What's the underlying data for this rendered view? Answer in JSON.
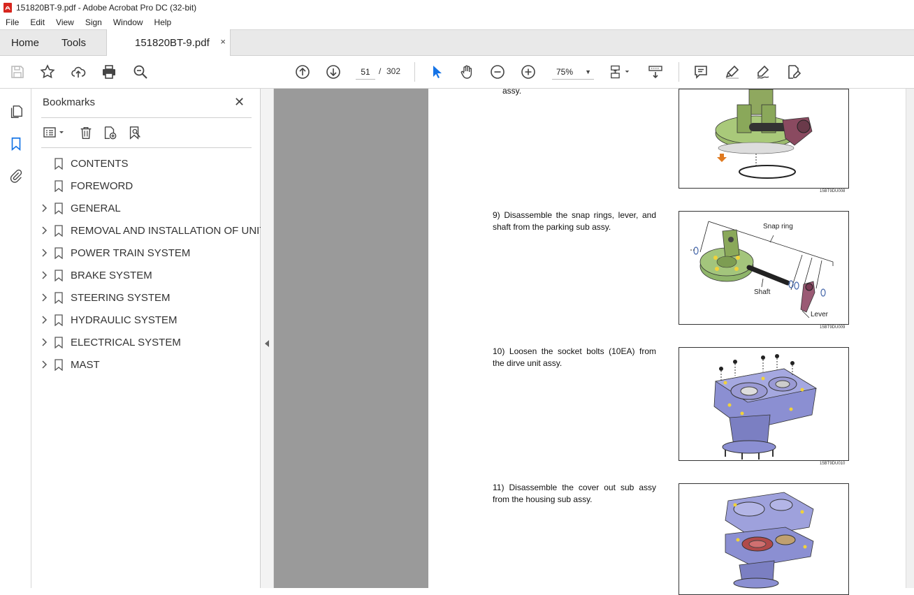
{
  "window": {
    "title": "151820BT-9.pdf - Adobe Acrobat Pro DC (32-bit)"
  },
  "menu": [
    "File",
    "Edit",
    "View",
    "Sign",
    "Window",
    "Help"
  ],
  "tabs": {
    "home": "Home",
    "tools": "Tools",
    "document": "151820BT-9.pdf",
    "close": "×"
  },
  "toolbar": {
    "current_page": "51",
    "separator": "/",
    "total_pages": "302",
    "zoom": "75%"
  },
  "bookmarks": {
    "title": "Bookmarks",
    "close": "✕",
    "items": [
      {
        "label": "CONTENTS",
        "expandable": false
      },
      {
        "label": "FOREWORD",
        "expandable": false
      },
      {
        "label": "GENERAL",
        "expandable": true
      },
      {
        "label": "REMOVAL AND INSTALLATION OF UNIT",
        "expandable": true
      },
      {
        "label": "POWER TRAIN SYSTEM",
        "expandable": true
      },
      {
        "label": "BRAKE SYSTEM",
        "expandable": true
      },
      {
        "label": "STEERING SYSTEM",
        "expandable": true
      },
      {
        "label": "HYDRAULIC SYSTEM",
        "expandable": true
      },
      {
        "label": "ELECTRICAL SYSTEM",
        "expandable": true
      },
      {
        "label": "MAST",
        "expandable": true
      }
    ]
  },
  "document": {
    "prev_fragment": "assy.",
    "steps": [
      {
        "num": "9)",
        "text": "Disassemble the snap rings, lever, and shaft from the parking sub assy."
      },
      {
        "num": "10)",
        "text": "Loosen the socket bolts (10EA) from the dirve unit assy."
      },
      {
        "num": "11)",
        "text": "Disassemble the cover out sub assy from the housing sub assy."
      }
    ],
    "figures": [
      {
        "code": "15BT9DU008"
      },
      {
        "code": "15BT9DU009",
        "labels": {
          "snap_ring": "Snap ring",
          "shaft": "Shaft",
          "lever": "Lever"
        }
      },
      {
        "code": "15BT9DU010"
      }
    ]
  },
  "colors": {
    "accent": "#1473e6",
    "panel_bg": "#ffffff",
    "doc_bg": "#9a9a9a"
  }
}
